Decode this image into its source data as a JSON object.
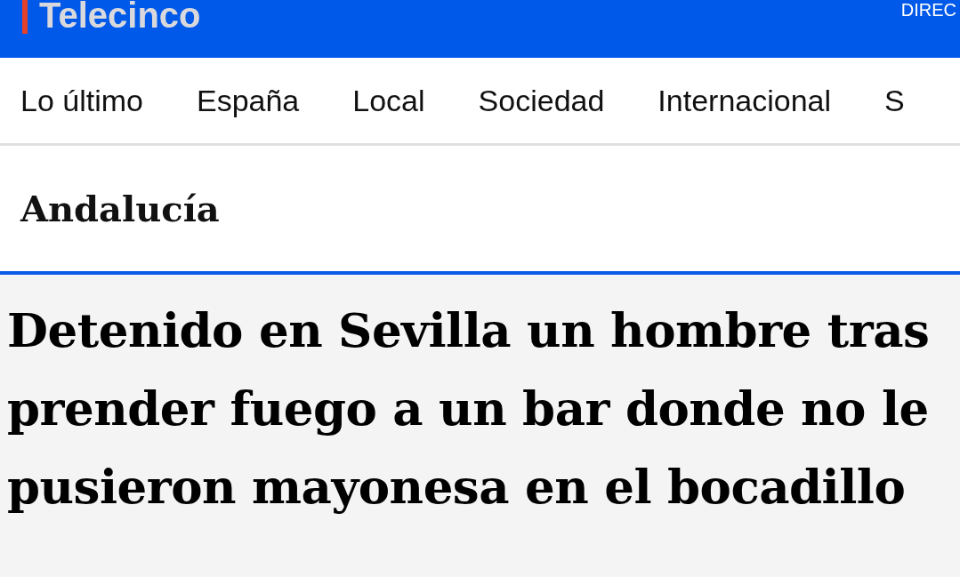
{
  "header": {
    "logo": "Telecinco",
    "live_link": "DIREC"
  },
  "nav": {
    "items": [
      {
        "label": "Lo último"
      },
      {
        "label": "España"
      },
      {
        "label": "Local"
      },
      {
        "label": "Sociedad"
      },
      {
        "label": "Internacional"
      },
      {
        "label": "S"
      }
    ]
  },
  "section": {
    "title": "Andalucía"
  },
  "article": {
    "headline": "Detenido en Sevilla un hombre tras prender fuego a un bar donde no le pusieron mayonesa en el bocadillo"
  }
}
